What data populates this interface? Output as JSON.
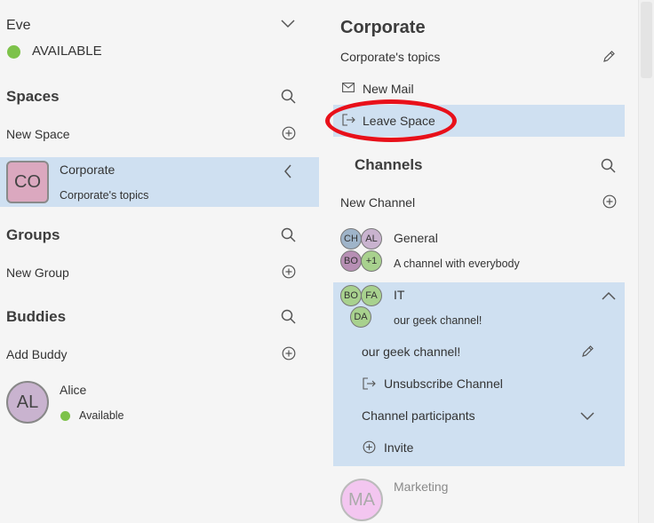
{
  "user": {
    "name": "Eve",
    "status": "AVAILABLE",
    "status_color": "#7dc24a"
  },
  "spaces": {
    "heading": "Spaces",
    "new_label": "New Space",
    "items": [
      {
        "initials": "CO",
        "name": "Corporate",
        "subtitle": "Corporate's topics",
        "avatar_color": "#dba8bf"
      }
    ]
  },
  "groups": {
    "heading": "Groups",
    "new_label": "New Group"
  },
  "buddies": {
    "heading": "Buddies",
    "add_label": "Add Buddy",
    "items": [
      {
        "initials": "AL",
        "name": "Alice",
        "status": "Available",
        "avatar_color": "#c9b3cf"
      }
    ]
  },
  "detail": {
    "title": "Corporate",
    "topic": "Corporate's topics",
    "new_mail": "New Mail",
    "leave_space": "Leave Space",
    "channels": {
      "heading": "Channels",
      "new_label": "New Channel",
      "items": [
        {
          "name": "General",
          "subtitle": "A channel with everybody",
          "avatars": [
            "CH",
            "AL",
            "BO",
            "+1"
          ]
        },
        {
          "name": "IT",
          "subtitle": "our geek channel!",
          "avatars": [
            "BO",
            "FA",
            "DA"
          ],
          "expanded": {
            "topic": "our geek channel!",
            "unsubscribe": "Unsubscribe Channel",
            "participants": "Channel participants",
            "invite": "Invite"
          }
        },
        {
          "name": "Marketing",
          "initials": "MA"
        }
      ]
    }
  },
  "colors": {
    "selection": "#cfe0f1",
    "annotation": "#e8101a",
    "panel": "#f5f5f5"
  }
}
